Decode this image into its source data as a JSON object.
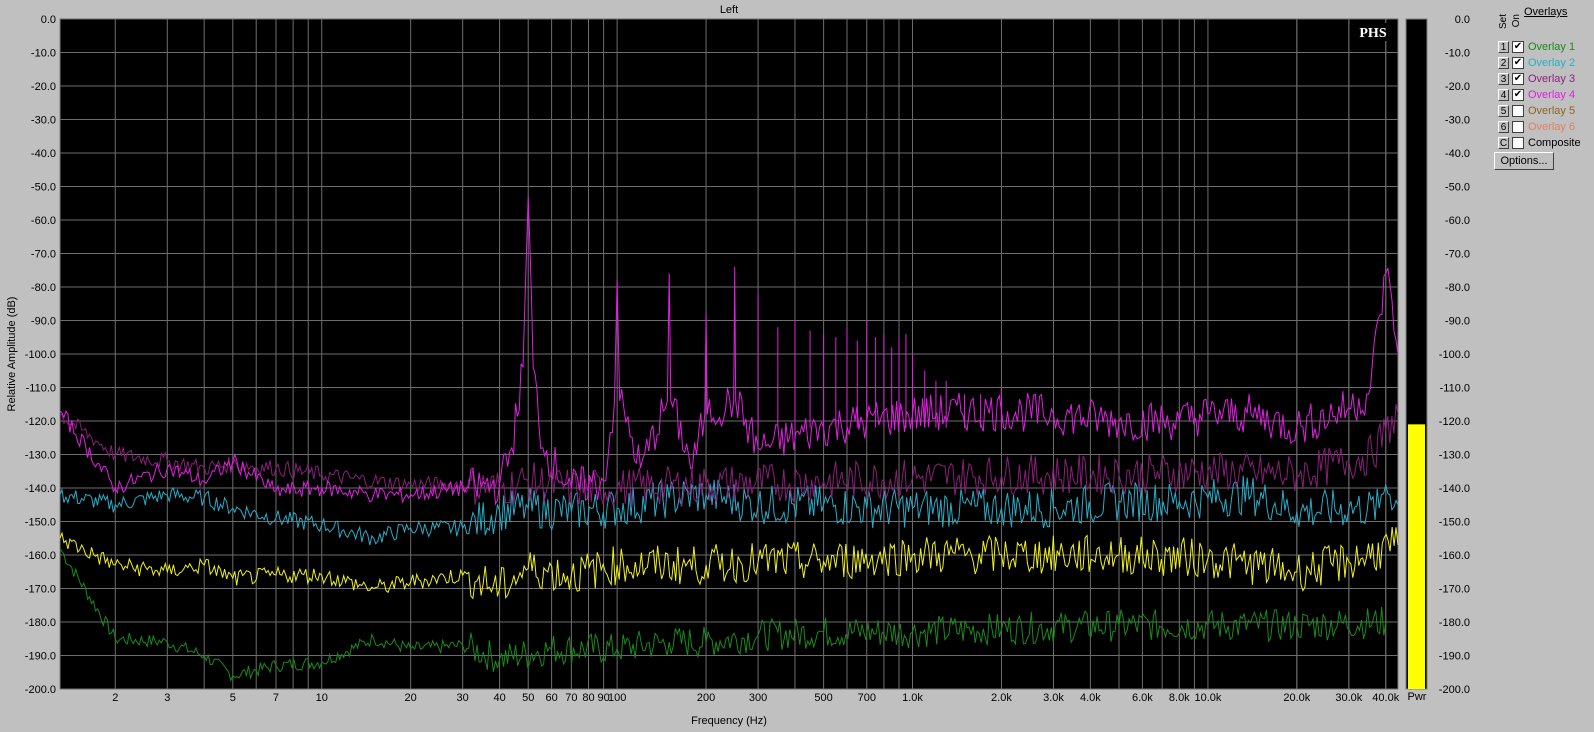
{
  "chart_data": {
    "type": "line",
    "title": "Left",
    "xlabel": "Frequency (Hz)",
    "ylabel": "Relative Amplitude (dB)",
    "x_scale": "log",
    "xlim": [
      1.3,
      44000
    ],
    "ylim": [
      -200,
      0
    ],
    "grid": true,
    "x_tick_labels": [
      {
        "v": 2,
        "t": "2"
      },
      {
        "v": 3,
        "t": "3"
      },
      {
        "v": 5,
        "t": "5"
      },
      {
        "v": 7,
        "t": "7"
      },
      {
        "v": 10,
        "t": "10"
      },
      {
        "v": 20,
        "t": "20"
      },
      {
        "v": 30,
        "t": "30"
      },
      {
        "v": 40,
        "t": "40"
      },
      {
        "v": 50,
        "t": "50"
      },
      {
        "v": 60,
        "t": "60"
      },
      {
        "v": 70,
        "t": "70"
      },
      {
        "v": 80,
        "t": "80"
      },
      {
        "v": 90,
        "t": "90"
      },
      {
        "v": 100,
        "t": "100"
      },
      {
        "v": 200,
        "t": "200"
      },
      {
        "v": 300,
        "t": "300"
      },
      {
        "v": 500,
        "t": "500"
      },
      {
        "v": 700,
        "t": "700"
      },
      {
        "v": 1000,
        "t": "1.0k"
      },
      {
        "v": 2000,
        "t": "2.0k"
      },
      {
        "v": 3000,
        "t": "3.0k"
      },
      {
        "v": 4000,
        "t": "4.0k"
      },
      {
        "v": 6000,
        "t": "6.0k"
      },
      {
        "v": 8000,
        "t": "8.0k"
      },
      {
        "v": 10000,
        "t": "10.0k"
      },
      {
        "v": 20000,
        "t": "20.0k"
      },
      {
        "v": 30000,
        "t": "30.0k"
      },
      {
        "v": 40000,
        "t": "40.0k"
      }
    ],
    "y_tick_labels": [
      "0.0",
      "-10.0",
      "-20.0",
      "-30.0",
      "-40.0",
      "-50.0",
      "-60.0",
      "-70.0",
      "-80.0",
      "-90.0",
      "-100.0",
      "-110.0",
      "-120.0",
      "-130.0",
      "-140.0",
      "-150.0",
      "-160.0",
      "-170.0",
      "-180.0",
      "-190.0",
      "-200.0"
    ],
    "series": [
      {
        "name": "Overlay 1",
        "color": "#1a8a1a",
        "points": [
          [
            1.3,
            -158
          ],
          [
            2,
            -185
          ],
          [
            3,
            -186
          ],
          [
            4,
            -190
          ],
          [
            5,
            -196
          ],
          [
            7,
            -193
          ],
          [
            10,
            -192
          ],
          [
            15,
            -185
          ],
          [
            20,
            -188
          ],
          [
            30,
            -187
          ],
          [
            40,
            -191
          ],
          [
            60,
            -188
          ],
          [
            100,
            -188
          ],
          [
            150,
            -186
          ],
          [
            200,
            -186
          ],
          [
            300,
            -184
          ],
          [
            500,
            -183
          ],
          [
            1000,
            -183
          ],
          [
            2000,
            -182
          ],
          [
            5000,
            -181
          ],
          [
            10000,
            -181
          ],
          [
            20000,
            -181
          ],
          [
            40000,
            -180
          ]
        ]
      },
      {
        "name": "Overlay 2",
        "color": "#2aacc8",
        "points": [
          [
            1.3,
            -142
          ],
          [
            2,
            -145
          ],
          [
            3,
            -142
          ],
          [
            4,
            -143
          ],
          [
            5,
            -146
          ],
          [
            7,
            -149
          ],
          [
            10,
            -151
          ],
          [
            15,
            -155
          ],
          [
            20,
            -152
          ],
          [
            30,
            -152
          ],
          [
            40,
            -147
          ],
          [
            50,
            -146
          ],
          [
            70,
            -147
          ],
          [
            100,
            -146
          ],
          [
            150,
            -143
          ],
          [
            200,
            -142
          ],
          [
            300,
            -145
          ],
          [
            500,
            -145
          ],
          [
            700,
            -146
          ],
          [
            1000,
            -146
          ],
          [
            2000,
            -146
          ],
          [
            3000,
            -146
          ],
          [
            5000,
            -144
          ],
          [
            8000,
            -144
          ],
          [
            10000,
            -143
          ],
          [
            14000,
            -142
          ],
          [
            20000,
            -147
          ],
          [
            30000,
            -146
          ],
          [
            38000,
            -146
          ],
          [
            40000,
            -139
          ],
          [
            44000,
            -145
          ]
        ]
      },
      {
        "name": "Overlay 3",
        "color": "#8a1f7a",
        "points": [
          [
            1.3,
            -118
          ],
          [
            2,
            -130
          ],
          [
            3,
            -132
          ],
          [
            4,
            -134
          ],
          [
            5,
            -133
          ],
          [
            7,
            -134
          ],
          [
            10,
            -136
          ],
          [
            15,
            -138
          ],
          [
            20,
            -139
          ],
          [
            30,
            -139
          ],
          [
            40,
            -140
          ],
          [
            50,
            -138
          ],
          [
            70,
            -140
          ],
          [
            100,
            -140
          ],
          [
            200,
            -139
          ],
          [
            500,
            -138
          ],
          [
            1000,
            -137
          ],
          [
            2000,
            -136
          ],
          [
            5000,
            -136
          ],
          [
            10000,
            -135
          ],
          [
            20000,
            -136
          ],
          [
            30000,
            -132
          ],
          [
            36000,
            -130
          ],
          [
            40000,
            -123
          ],
          [
            44000,
            -118
          ]
        ]
      },
      {
        "name": "Overlay 4",
        "color": "#e020e0",
        "points": [
          [
            1.3,
            -117
          ],
          [
            2,
            -140
          ],
          [
            3,
            -134
          ],
          [
            4,
            -138
          ],
          [
            5,
            -132
          ],
          [
            7,
            -141
          ],
          [
            10,
            -140
          ],
          [
            15,
            -142
          ],
          [
            20,
            -142
          ],
          [
            30,
            -140
          ],
          [
            40,
            -139
          ],
          [
            44,
            -128
          ],
          [
            48,
            -104
          ],
          [
            50,
            -53
          ],
          [
            52,
            -104
          ],
          [
            56,
            -128
          ],
          [
            70,
            -140
          ],
          [
            90,
            -138
          ],
          [
            98,
            -114
          ],
          [
            100,
            -78
          ],
          [
            102,
            -114
          ],
          [
            120,
            -134
          ],
          [
            148,
            -114
          ],
          [
            150,
            -76
          ],
          [
            152,
            -114
          ],
          [
            180,
            -134
          ],
          [
            198,
            -118
          ],
          [
            200,
            -88
          ],
          [
            202,
            -118
          ],
          [
            248,
            -114
          ],
          [
            250,
            -74
          ],
          [
            252,
            -114
          ],
          [
            300,
            -128
          ],
          [
            500,
            -122
          ],
          [
            700,
            -120
          ],
          [
            1000,
            -118
          ],
          [
            2000,
            -117
          ],
          [
            3000,
            -118
          ],
          [
            5000,
            -120
          ],
          [
            8000,
            -120
          ],
          [
            10000,
            -118
          ],
          [
            14000,
            -118
          ],
          [
            20000,
            -122
          ],
          [
            30000,
            -116
          ],
          [
            35000,
            -112
          ],
          [
            40000,
            -76
          ],
          [
            42000,
            -84
          ],
          [
            44000,
            -100
          ]
        ]
      },
      {
        "name": "Composite",
        "color": "#f0f020",
        "points": [
          [
            1.3,
            -155
          ],
          [
            2,
            -163
          ],
          [
            3,
            -165
          ],
          [
            4,
            -163
          ],
          [
            5,
            -167
          ],
          [
            7,
            -166
          ],
          [
            10,
            -166
          ],
          [
            15,
            -170
          ],
          [
            20,
            -168
          ],
          [
            30,
            -166
          ],
          [
            40,
            -170
          ],
          [
            50,
            -164
          ],
          [
            70,
            -166
          ],
          [
            100,
            -163
          ],
          [
            200,
            -163
          ],
          [
            300,
            -162
          ],
          [
            500,
            -162
          ],
          [
            1000,
            -160
          ],
          [
            2000,
            -160
          ],
          [
            5000,
            -160
          ],
          [
            10000,
            -161
          ],
          [
            20000,
            -165
          ],
          [
            30000,
            -162
          ],
          [
            44000,
            -157
          ]
        ]
      }
    ],
    "power_meter": {
      "label": "Pwr",
      "value_db": -121,
      "color": "#ffff00"
    }
  },
  "logo": "PHS",
  "overlays_panel": {
    "title": "Overlays",
    "header_set": "Set",
    "header_on": "On",
    "options_label": "Options...",
    "rows": [
      {
        "set": "1",
        "checked": true,
        "name": "Overlay 1",
        "color": "#1a8a1a"
      },
      {
        "set": "2",
        "checked": true,
        "name": "Overlay 2",
        "color": "#20b0c8"
      },
      {
        "set": "3",
        "checked": true,
        "name": "Overlay 3",
        "color": "#902080"
      },
      {
        "set": "4",
        "checked": true,
        "name": "Overlay 4",
        "color": "#e020e0"
      },
      {
        "set": "5",
        "checked": false,
        "name": "Overlay 5",
        "color": "#8a6420"
      },
      {
        "set": "6",
        "checked": false,
        "name": "Overlay 6",
        "color": "#e08060"
      },
      {
        "set": "C",
        "checked": false,
        "name": "Composite",
        "color": "#000000"
      }
    ]
  }
}
